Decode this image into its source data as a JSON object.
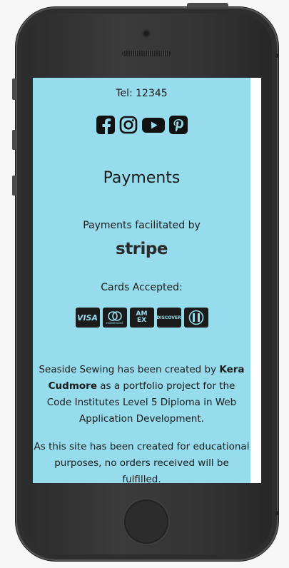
{
  "footer": {
    "tel": "Tel: 12345",
    "socials": [
      "facebook-icon",
      "instagram-icon",
      "youtube-icon",
      "pinterest-icon"
    ],
    "payments_heading": "Payments",
    "facilitated_text": "Payments facilitated by",
    "stripe_logo": "stripe",
    "cards_label": "Cards Accepted:",
    "cards": [
      "VISA",
      "mastercard",
      "AMEX",
      "DISCOVER",
      "diners"
    ],
    "about_pre": "Seaside Sewing has been created by ",
    "about_name": "Kera Cudmore",
    "about_post": " as a portfolio project for the Code Institutes Level 5 Diploma in Web Application Development.",
    "disclaimer": "As this site has been created for educational purposes, no orders received will be fulfilled."
  },
  "colors": {
    "background": "#96dcec",
    "text": "#1a1a1a"
  }
}
